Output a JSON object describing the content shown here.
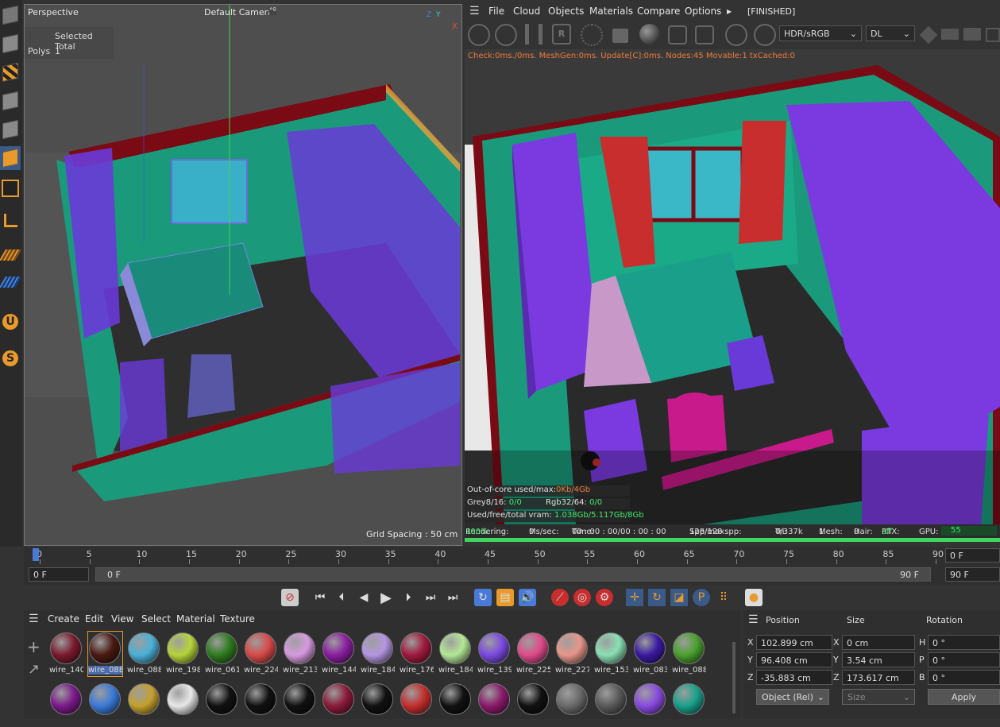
{
  "viewport": {
    "view_name": "Perspective",
    "camera": "Default Camera",
    "camera_suffix": "°º",
    "selected_total": "Selected Total",
    "polys_label": "Polys",
    "polys_value": "1",
    "grid_spacing": "Grid Spacing : 50 cm",
    "axis_x": "X",
    "axis_y": "Y",
    "axis_z": "Z"
  },
  "render_menu": {
    "items": [
      "File",
      "Cloud",
      "Objects",
      "Materials",
      "Compare",
      "Options"
    ],
    "more": "▸",
    "status": "[FINISHED]",
    "color_space": "HDR/sRGB",
    "kernel": "DL"
  },
  "render_info": {
    "check_line": "Check:0ms./0ms. MeshGen:0ms. Update[C]:0ms. Nodes:45 Movable:1 txCached:0",
    "out_of_core_label": "Out-of-core used/max:",
    "out_of_core_value": "0Kb/4Gb",
    "grey_label": "Grey8/16:",
    "grey_value": "0/0",
    "rgb_label": "Rgb32/64:",
    "rgb_value": "0/0",
    "vram_label": "Used/free/total vram:",
    "vram_value": "1.038Gb/5.117Gb/8Gb"
  },
  "status_bar": {
    "rendering_label": "Rendering:",
    "rendering_value": "100%",
    "ms_sec_label": "Ms/sec:",
    "ms_sec_value": "0",
    "time_label": "Time:",
    "time_value": "00 : 00 : 00/00 : 00 : 00",
    "spp_label": "Spp/maxspp:",
    "spp_value": "128/128",
    "tri_label": "Tri:",
    "tri_value": "0/337k",
    "mesh_label": "Mesh:",
    "mesh_value": "1",
    "hair_label": "Hair:",
    "hair_value": "0",
    "rtx_label": "RTX:",
    "rtx_value": "off",
    "gpu_label": "GPU:",
    "gpu_value": "55",
    "progress": 1.0
  },
  "timeline": {
    "ticks": [
      "0",
      "5",
      "10",
      "15",
      "20",
      "25",
      "30",
      "35",
      "40",
      "45",
      "50",
      "55",
      "60",
      "65",
      "70",
      "75",
      "80",
      "85",
      "90"
    ],
    "current_frame": "0 F",
    "start_frame": "0 F",
    "range_start": "0 F",
    "range_end": "90 F",
    "end_frame": "90 F",
    "max_frame": "90 F"
  },
  "material_manager": {
    "menu": [
      "Create",
      "Edit",
      "View",
      "Select",
      "Material",
      "Texture"
    ],
    "row1": [
      {
        "name": "wire_140",
        "color": "#7a1a2e"
      },
      {
        "name": "wire_088",
        "color": "#4a1a12"
      },
      {
        "name": "wire_088",
        "color": "#4bb0d8"
      },
      {
        "name": "wire_198",
        "color": "#b6d43a"
      },
      {
        "name": "wire_061",
        "color": "#2e7a1e"
      },
      {
        "name": "wire_224",
        "color": "#d84a4a"
      },
      {
        "name": "wire_213",
        "color": "#d89ae0"
      },
      {
        "name": "wire_144",
        "color": "#8a1ea0"
      },
      {
        "name": "wire_184",
        "color": "#b496e0"
      },
      {
        "name": "wire_176",
        "color": "#a01a3e"
      },
      {
        "name": "wire_184",
        "color": "#b4e896"
      },
      {
        "name": "wire_139",
        "color": "#7a4ae0"
      },
      {
        "name": "wire_225",
        "color": "#e04a8a"
      },
      {
        "name": "wire_227",
        "color": "#e8968a"
      },
      {
        "name": "wire_153",
        "color": "#8ae0b4"
      },
      {
        "name": "wire_083",
        "color": "#3a1aa0"
      },
      {
        "name": "wire_088",
        "color": "#4aa02e"
      }
    ],
    "row2": [
      {
        "color": "#7a1a8a"
      },
      {
        "color": "#3a7ad8"
      },
      {
        "color": "#c4a02e"
      },
      {
        "color": "#e8e8e8"
      },
      {
        "color": "#111111"
      },
      {
        "color": "#111111"
      },
      {
        "color": "#111111"
      },
      {
        "color": "#8a1a3a"
      },
      {
        "color": "#111111"
      },
      {
        "color": "#c42e2e"
      },
      {
        "color": "#111111"
      },
      {
        "color": "#8a1a6a"
      },
      {
        "color": "#111111"
      },
      {
        "color": "#6a6a6a"
      },
      {
        "color": "#5a5a5a"
      },
      {
        "color": "#8a4ae0"
      },
      {
        "color": "#1aa08a"
      }
    ],
    "selected_index": 1
  },
  "attributes": {
    "position_header": "Position",
    "size_header": "Size",
    "rotation_header": "Rotation",
    "px_label": "X",
    "px": "102.899 cm",
    "py_label": "Y",
    "py": "96.408 cm",
    "pz_label": "Z",
    "pz": "-35.883 cm",
    "sx_label": "X",
    "sx": "0 cm",
    "sy_label": "Y",
    "sy": "3.54 cm",
    "sz_label": "Z",
    "sz": "173.617 cm",
    "rh_label": "H",
    "rh": "0 °",
    "rp_label": "P",
    "rp": "0 °",
    "rb_label": "B",
    "rb": "0 °",
    "coord_mode": "Object (Rel)",
    "size_mode": "Size",
    "apply": "Apply"
  },
  "colors": {
    "teal_wall": "#1a9a7a",
    "purple_furniture": "#7a3ae0",
    "red_frame": "#8a0a14",
    "progress_green": "#3fd65f"
  }
}
